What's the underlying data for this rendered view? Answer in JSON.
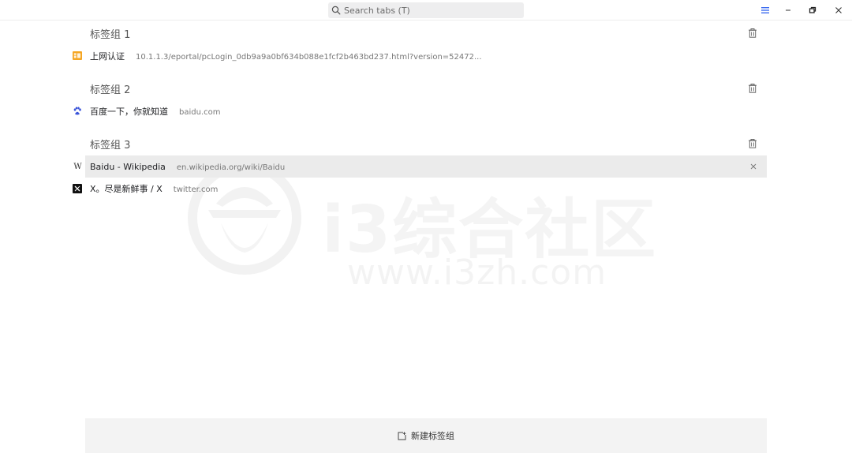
{
  "search": {
    "placeholder": "Search tabs (T)"
  },
  "window_controls": {
    "menu_icon": "hamburger-icon",
    "minimize_icon": "minimize-icon",
    "restore_icon": "restore-icon",
    "close_icon": "close-icon"
  },
  "groups": [
    {
      "title": "标签组 1",
      "tabs": [
        {
          "title": "上网认证",
          "url": "10.1.1.3/eportal/pcLogin_0db9a9a0bf634b088e1fcf2b463bd237.html?version=52472...",
          "favicon": "portal-icon"
        }
      ]
    },
    {
      "title": "标签组 2",
      "tabs": [
        {
          "title": "百度一下，你就知道",
          "url": "baidu.com",
          "favicon": "baidu-paw-icon"
        }
      ]
    },
    {
      "title": "标签组 3",
      "tabs": [
        {
          "title": "Baidu - Wikipedia",
          "url": "en.wikipedia.org/wiki/Baidu",
          "favicon": "wikipedia-icon"
        },
        {
          "title": "X。尽是新鲜事 / X",
          "url": "twitter.com",
          "favicon": "x-logo-icon"
        }
      ]
    }
  ],
  "watermark": {
    "name": "i3综合社区",
    "url": "www.i3zh.com"
  },
  "footer": {
    "new_group_label": "新建标签组"
  },
  "colors": {
    "accent": "#3d6cf0",
    "hover_row": "#ebebeb",
    "search_bg": "#eeeeef",
    "footer_bg": "#f3f3f3"
  }
}
